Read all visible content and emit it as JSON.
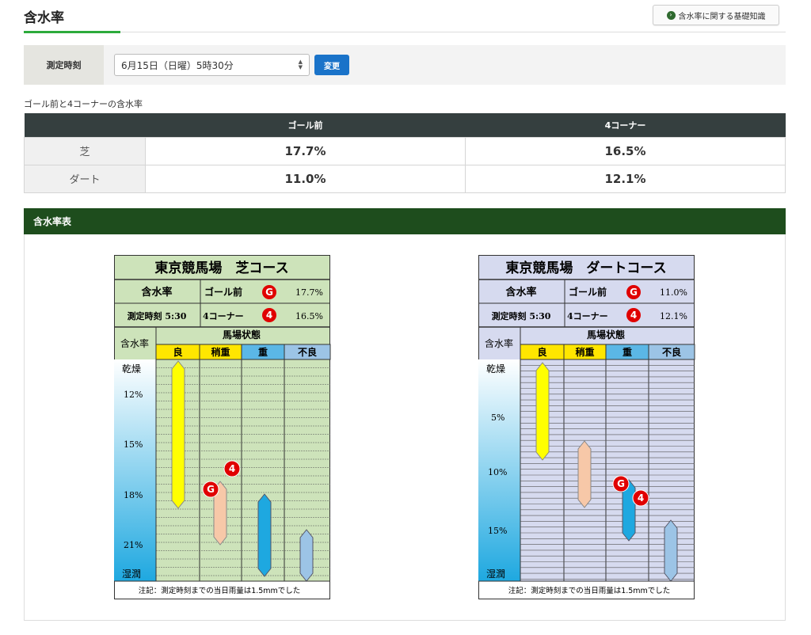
{
  "header": {
    "title": "含水率",
    "knowledge_button": "含水率に関する基礎知識",
    "knowledge_icon": "circle-arrow-icon"
  },
  "time_bar": {
    "label": "測定時刻",
    "selected": "6月15日（日曜）5時30分",
    "change_button": "変更"
  },
  "summary": {
    "caption": "ゴール前と4コーナーの含水率",
    "columns": [
      "ゴール前",
      "4コーナー"
    ],
    "rows": [
      {
        "label": "芝",
        "goal": "17.7%",
        "corner": "16.5%"
      },
      {
        "label": "ダート",
        "goal": "11.0%",
        "corner": "12.1%"
      }
    ]
  },
  "section": {
    "title": "含水率表"
  },
  "charts": [
    {
      "title": "東京競馬場　芝コース",
      "label_moisture": "含水率",
      "label_time": "測定時刻 5:30",
      "goal_label": "ゴール前",
      "goal_value": "17.7%",
      "corner_label": "4コーナー",
      "corner_value": "16.5%",
      "axis_label": "含水率",
      "state_label": "馬場状態",
      "states": [
        "良",
        "稍重",
        "重",
        "不良"
      ],
      "axis_top": "乾燥",
      "axis_bottom": "湿潤",
      "ticks": [
        "12%",
        "15%",
        "18%",
        "21%"
      ],
      "note": "注記：測定時刻までの当日雨量は1.5mmでした",
      "bg": "#cde3ba",
      "title_bg": "#cde3ba"
    },
    {
      "title": "東京競馬場　ダートコース",
      "label_moisture": "含水率",
      "label_time": "測定時刻 5:30",
      "goal_label": "ゴール前",
      "goal_value": "11.0%",
      "corner_label": "4コーナー",
      "corner_value": "12.1%",
      "axis_label": "含水率",
      "state_label": "馬場状態",
      "states": [
        "良",
        "稍重",
        "重",
        "不良"
      ],
      "axis_top": "乾燥",
      "axis_bottom": "湿潤",
      "ticks": [
        "5%",
        "10%",
        "15%"
      ],
      "note": "注記：測定時刻までの当日雨量は1.5mmでした",
      "bg": "#d6daef",
      "title_bg": "#d6daef"
    }
  ],
  "markers": {
    "goal": "G",
    "corner": "4",
    "color": "#e00000"
  },
  "colors": {
    "state_header": "#ffe600",
    "state_head_alt": "#5bb7e6",
    "good": "#ffff00",
    "slightly_heavy": "#f7c8a8",
    "heavy": "#1ea8e0",
    "bad": "#9cc4e6"
  }
}
